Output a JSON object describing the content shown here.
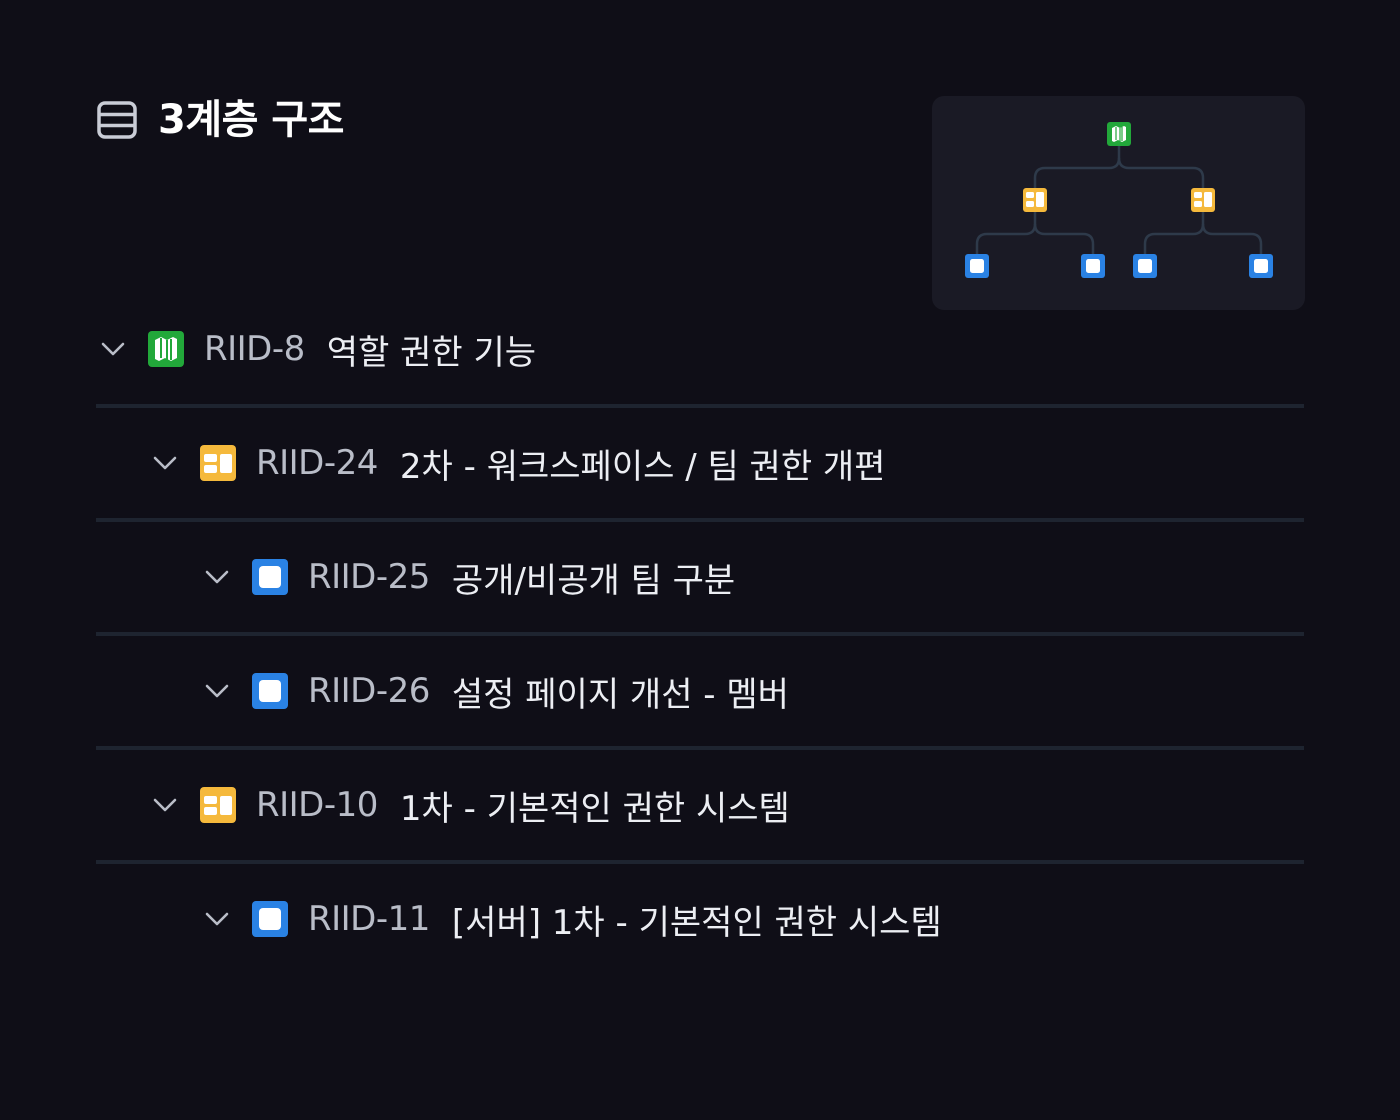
{
  "header": {
    "title": "3계층 구조",
    "icon": "list-icon"
  },
  "minimap": {
    "icon": "hierarchy-minimap",
    "colors": {
      "epic": "#22a83a",
      "story": "#f5b93c",
      "task": "#2a82e4",
      "line": "#2e3a4a"
    }
  },
  "issue_types": {
    "epic": {
      "icon": "epic-map-icon",
      "color": "#22a83a"
    },
    "story": {
      "icon": "story-icon",
      "color": "#f5b93c"
    },
    "task": {
      "icon": "task-icon",
      "color": "#2a82e4"
    }
  },
  "tree": {
    "rows": [
      {
        "key": "RIID-8",
        "title": "역할 권한 기능",
        "type": "epic",
        "level": 1
      },
      {
        "key": "RIID-24",
        "title": "2차 - 워크스페이스 / 팀 권한 개편",
        "type": "story",
        "level": 2
      },
      {
        "key": "RIID-25",
        "title": "공개/비공개 팀 구분",
        "type": "task",
        "level": 3
      },
      {
        "key": "RIID-26",
        "title": "설정 페이지 개선 - 멤버",
        "type": "task",
        "level": 3
      },
      {
        "key": "RIID-10",
        "title": "1차 - 기본적인 권한 시스템",
        "type": "story",
        "level": 2
      },
      {
        "key": "RIID-11",
        "title": "[서버] 1차 - 기본적인 권한 시스템",
        "type": "task",
        "level": 3
      }
    ]
  }
}
